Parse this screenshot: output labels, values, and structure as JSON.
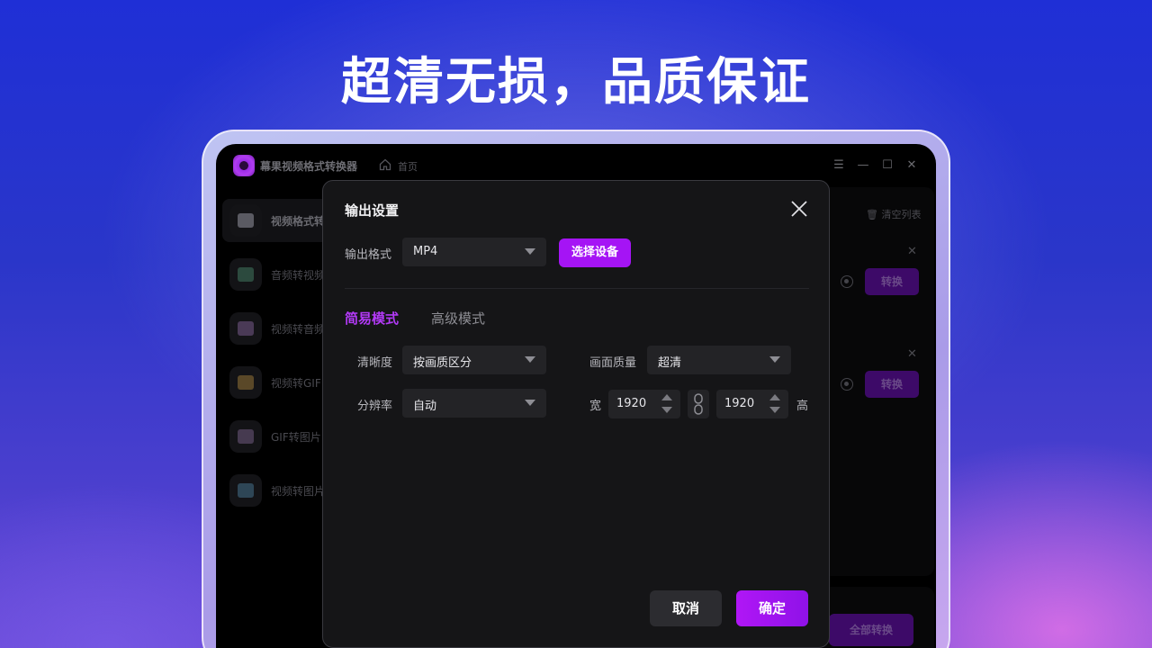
{
  "headline": "超清无损，品质保证",
  "app": {
    "title": "幕果视频格式转换器",
    "home_label": "首页",
    "window_controls": [
      "menu-icon",
      "minimize-icon",
      "maximize-icon",
      "close-icon"
    ]
  },
  "sidebar": {
    "items": [
      {
        "label": "视频格式转",
        "icon": "video-convert-icon",
        "active": true
      },
      {
        "label": "音频转视频",
        "icon": "audio-to-video-icon"
      },
      {
        "label": "视频转音频",
        "icon": "video-to-audio-icon"
      },
      {
        "label": "视频转GIF",
        "icon": "video-to-gif-icon"
      },
      {
        "label": "GIF转图片",
        "icon": "gif-to-image-icon"
      },
      {
        "label": "视频转图片",
        "icon": "video-to-image-icon"
      }
    ]
  },
  "list": {
    "clear_label": "清空列表",
    "convert_label": "转换",
    "convert_all_label": "全部转换"
  },
  "dialog": {
    "title": "输出设置",
    "format_label": "输出格式",
    "format_value": "MP4",
    "device_button": "选择设备",
    "tabs": {
      "simple": "简易模式",
      "advanced": "高级模式"
    },
    "clarity_label": "清晰度",
    "clarity_value": "按画质区分",
    "quality_label": "画面质量",
    "quality_value": "超清",
    "resolution_label": "分辨率",
    "resolution_value": "自动",
    "width_label": "宽",
    "width_value": "1920",
    "height_label": "高",
    "height_value": "1920",
    "cancel_label": "取消",
    "ok_label": "确定"
  },
  "colors": {
    "accent": "#a514f5",
    "dialog_bg": "#151517"
  }
}
